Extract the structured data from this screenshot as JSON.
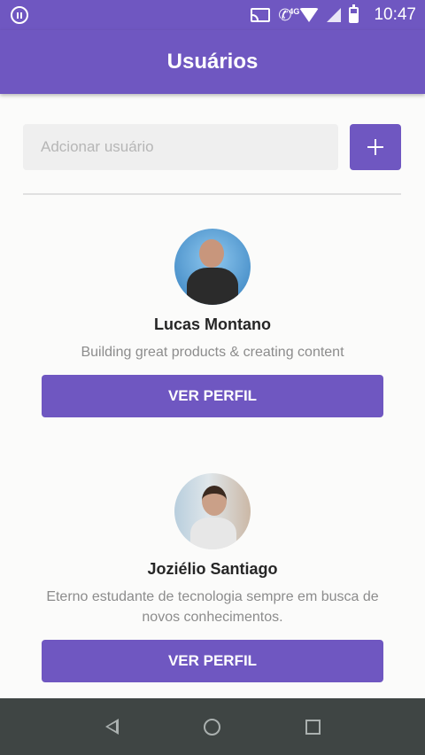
{
  "status_bar": {
    "time": "10:47",
    "network_badge": "4G",
    "icons": [
      "pause-circle-icon",
      "cast-icon",
      "phone-icon",
      "wifi-icon",
      "signal-icon",
      "battery-icon"
    ]
  },
  "app_bar": {
    "title": "Usuários"
  },
  "add_user": {
    "placeholder": "Adcionar usuário",
    "value": "",
    "button_icon": "plus-icon"
  },
  "users": [
    {
      "name": "Lucas Montano",
      "bio": "Building great products & creating content",
      "button_label": "VER PERFIL"
    },
    {
      "name": "Joziélio Santiago",
      "bio": "Eterno estudante de tecnologia sempre em busca de novos conhecimentos.",
      "button_label": "VER PERFIL"
    }
  ],
  "nav_bar": {
    "icons": [
      "back-icon",
      "home-icon",
      "recents-icon"
    ]
  },
  "colors": {
    "primary": "#6f57c1",
    "background": "#fbfbfa",
    "nav_bar": "#3f4544",
    "input_background": "#efefef",
    "bio_text": "#8c8c8c"
  }
}
